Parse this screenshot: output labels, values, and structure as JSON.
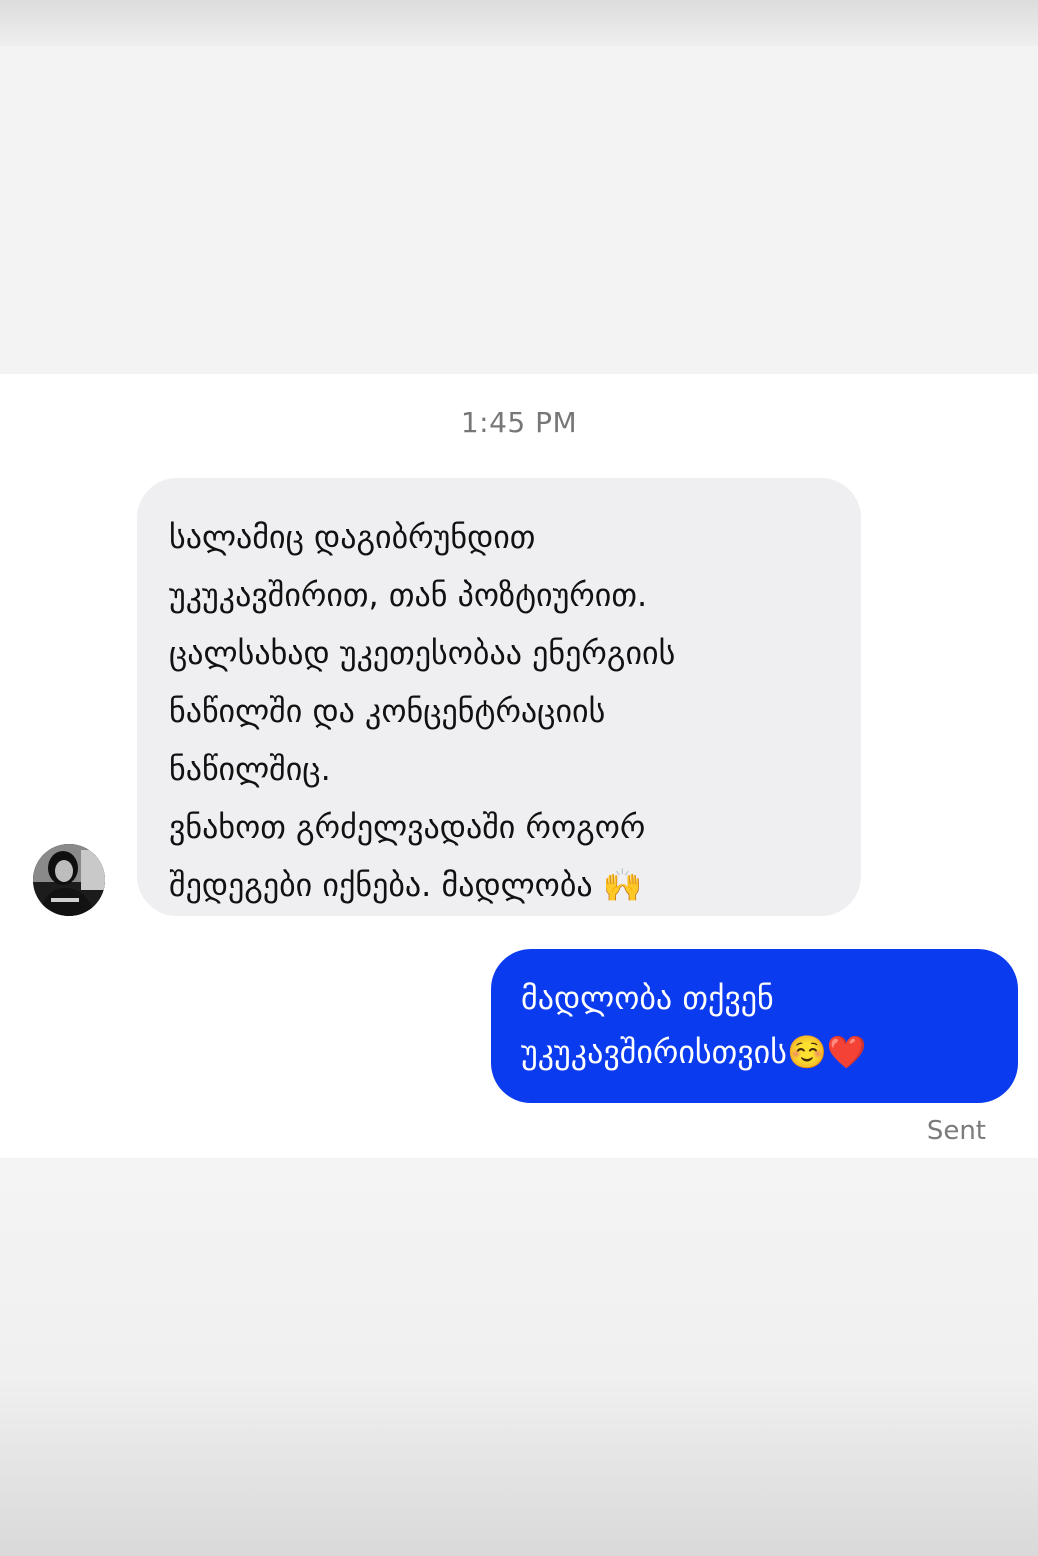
{
  "chat": {
    "timestamp": "1:45 PM",
    "incoming": {
      "lines": [
        "სალამიც დაგიბრუნდით",
        "უკუკავშირით, თან პოზტიურით.",
        "ცალსახად უკეთესობაა ენერგიის",
        "ნაწილში და კონცენტრაციის",
        "ნაწილშიც.",
        "ვნახოთ გრძელვადაში როგორ",
        "შედეგები იქნება. მადლობა 🙌"
      ]
    },
    "outgoing": {
      "lines": [
        "მადლობა თქვენ",
        "უკუკავშირისთვის☺️❤️"
      ]
    },
    "status": "Sent"
  },
  "colors": {
    "incoming_bubble": "#efeff2",
    "outgoing_bubble": "#0a3bef",
    "outgoing_text": "#ffffff",
    "timestamp_text": "#777777"
  },
  "icons": {
    "avatar": "contact-avatar-photo"
  }
}
